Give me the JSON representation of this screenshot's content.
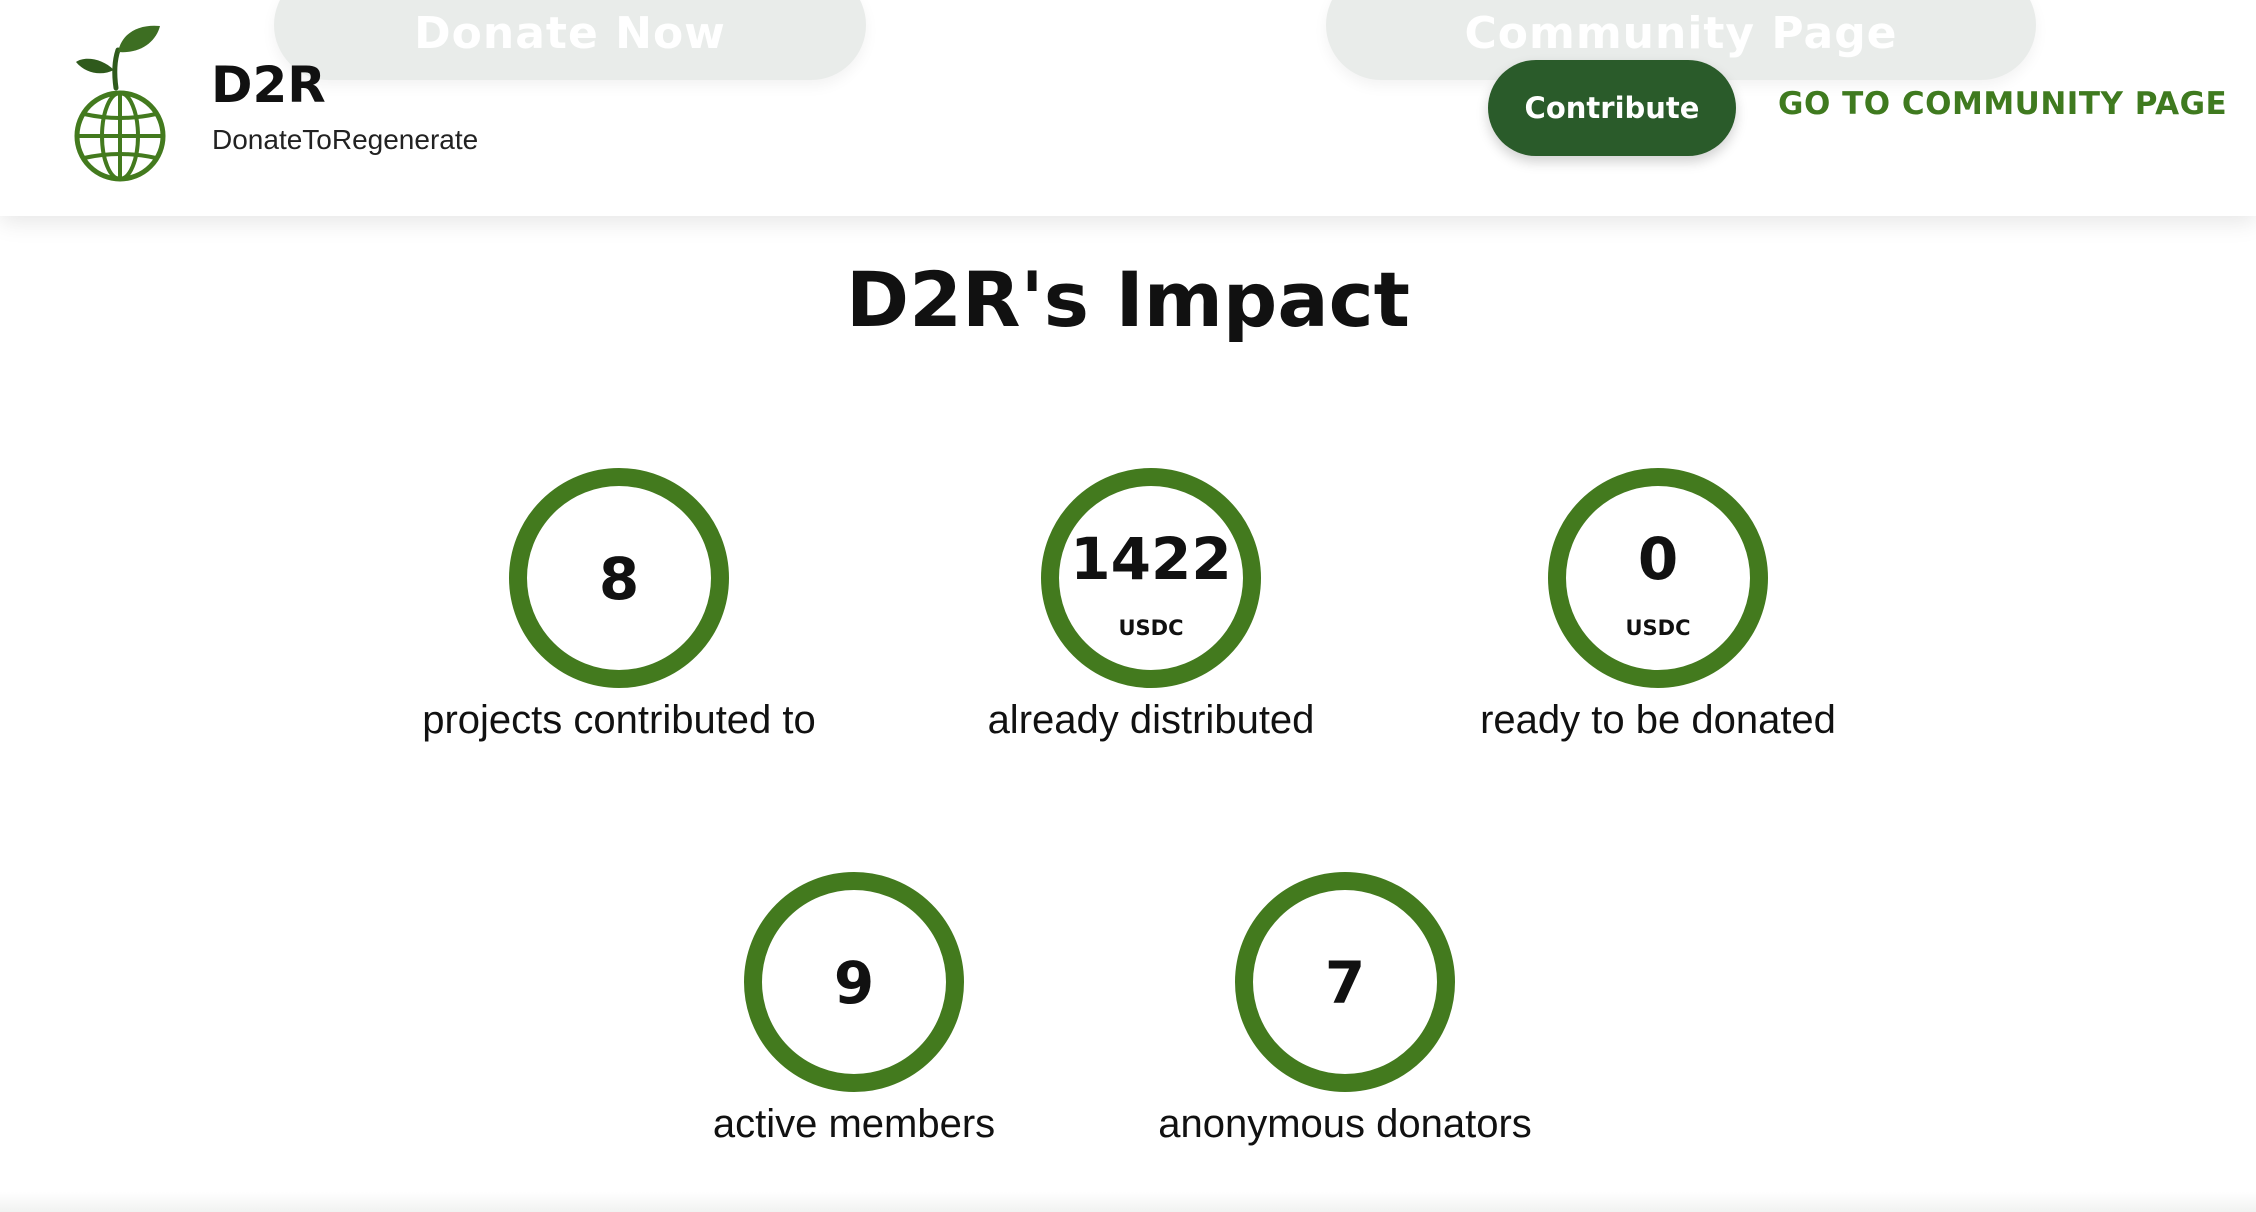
{
  "header": {
    "ghost_buttons": {
      "donate_label": "Donate Now",
      "community_label": "Community Page"
    },
    "brand": {
      "name": "D2R",
      "tagline": "DonateToRegenerate",
      "logo_icon": "globe-sprout-icon"
    },
    "contribute_label": "Contribute",
    "community_link_label": "GO TO COMMUNITY PAGE"
  },
  "main": {
    "title": "D2R's Impact",
    "stats": [
      {
        "value": "8",
        "unit": "",
        "label": "projects contributed to"
      },
      {
        "value": "1422",
        "unit": "USDC",
        "label": "already distributed"
      },
      {
        "value": "0",
        "unit": "USDC",
        "label": "ready to be donated"
      },
      {
        "value": "9",
        "unit": "",
        "label": "active members"
      },
      {
        "value": "7",
        "unit": "",
        "label": "anonymous donators"
      }
    ]
  },
  "colors": {
    "brand_green": "#437a1e",
    "button_dark_green": "#2a5b2a",
    "link_green": "#3f7a1f"
  }
}
